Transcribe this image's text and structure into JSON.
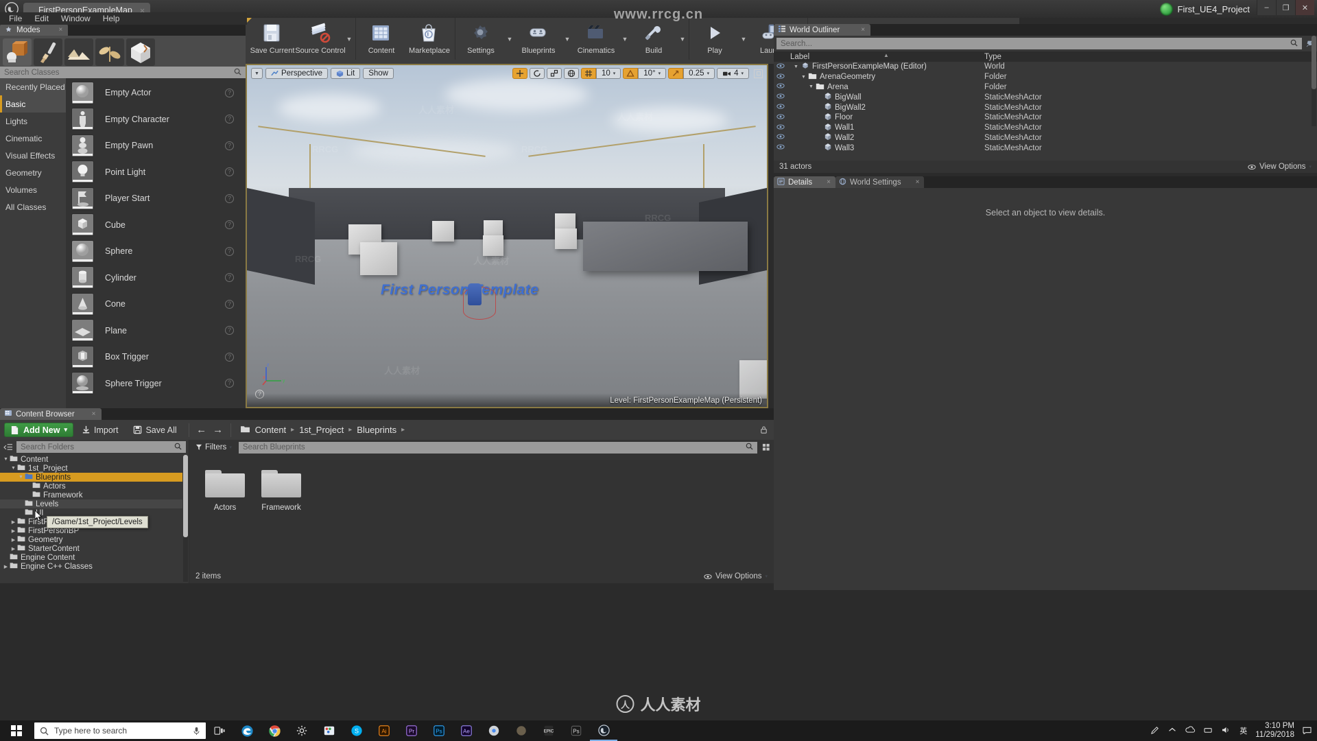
{
  "window": {
    "map_tab": "FirstPersonExampleMap",
    "watermark_top": "www.rrcg.cn",
    "project_name": "First_UE4_Project",
    "btn_minimize": "–",
    "btn_maximize": "❐",
    "btn_close": "✕"
  },
  "menu": {
    "items": [
      "File",
      "Edit",
      "Window",
      "Help"
    ]
  },
  "modes": {
    "tab_label": "Modes",
    "close": "×",
    "mode_buttons": [
      "place-mode",
      "paint-mode",
      "landscape-mode",
      "foliage-mode",
      "geometry-edit-mode"
    ],
    "search_placeholder": "Search Classes",
    "categories": [
      {
        "label": "Recently Placed",
        "state": "recent"
      },
      {
        "label": "Basic",
        "state": "selected"
      },
      {
        "label": "Lights",
        "state": "normal"
      },
      {
        "label": "Cinematic",
        "state": "normal"
      },
      {
        "label": "Visual Effects",
        "state": "normal"
      },
      {
        "label": "Geometry",
        "state": "normal"
      },
      {
        "label": "Volumes",
        "state": "normal"
      },
      {
        "label": "All Classes",
        "state": "normal"
      }
    ],
    "actors": [
      {
        "label": "Empty Actor",
        "icon": "sphere-thumb"
      },
      {
        "label": "Empty Character",
        "icon": "character-thumb"
      },
      {
        "label": "Empty Pawn",
        "icon": "pawn-thumb"
      },
      {
        "label": "Point Light",
        "icon": "pointlight-thumb"
      },
      {
        "label": "Player Start",
        "icon": "playerstart-thumb"
      },
      {
        "label": "Cube",
        "icon": "cube-thumb"
      },
      {
        "label": "Sphere",
        "icon": "sphere-thumb"
      },
      {
        "label": "Cylinder",
        "icon": "cylinder-thumb"
      },
      {
        "label": "Cone",
        "icon": "cone-thumb"
      },
      {
        "label": "Plane",
        "icon": "plane-thumb"
      },
      {
        "label": "Box Trigger",
        "icon": "boxtrigger-thumb"
      },
      {
        "label": "Sphere Trigger",
        "icon": "spheretrigger-thumb"
      }
    ],
    "help_glyph": "?"
  },
  "toolbar": {
    "groups": [
      {
        "items": [
          {
            "label": "Save Current",
            "icon": "save-icon",
            "caret": false
          },
          {
            "label": "Source Control",
            "icon": "source-control-icon",
            "caret": true
          }
        ]
      },
      {
        "items": [
          {
            "label": "Content",
            "icon": "content-icon",
            "caret": false
          },
          {
            "label": "Marketplace",
            "icon": "marketplace-icon",
            "caret": false
          }
        ]
      },
      {
        "items": [
          {
            "label": "Settings",
            "icon": "settings-icon",
            "caret": true
          },
          {
            "label": "Blueprints",
            "icon": "blueprints-icon",
            "caret": true
          },
          {
            "label": "Cinematics",
            "icon": "cinematics-icon",
            "caret": true
          },
          {
            "label": "Build",
            "icon": "build-icon",
            "caret": true
          }
        ]
      },
      {
        "items": [
          {
            "label": "Play",
            "icon": "play-icon",
            "caret": true
          },
          {
            "label": "Launch",
            "icon": "launch-icon",
            "caret": true
          }
        ]
      }
    ],
    "caret_glyph": "▼"
  },
  "viewport": {
    "view_menu_caret": "▼",
    "perspective": "Perspective",
    "lit": "Lit",
    "show": "Show",
    "grid_snap_value": "10",
    "rotation_snap_value": "10°",
    "scale_snap_value": "0.25",
    "camera_speed_value": "4",
    "level_label": "Level:",
    "level_name": "FirstPersonExampleMap (Persistent)",
    "overlay_title": "First Person Template",
    "axis_x": "x",
    "axis_y": "y",
    "axis_z": "z",
    "help_glyph": "?"
  },
  "outliner": {
    "tab_label": "World Outliner",
    "close": "×",
    "search_placeholder": "Search...",
    "columns": [
      "Label",
      "Type"
    ],
    "rows": [
      {
        "label": "FirstPersonExampleMap (Editor)",
        "type": "World",
        "indent": 0,
        "icon": "world-icon",
        "expander": "▼"
      },
      {
        "label": "ArenaGeometry",
        "type": "Folder",
        "indent": 1,
        "icon": "folder-icon",
        "expander": "▼"
      },
      {
        "label": "Arena",
        "type": "Folder",
        "indent": 2,
        "icon": "folder-icon",
        "expander": "▼"
      },
      {
        "label": "BigWall",
        "type": "StaticMeshActor",
        "indent": 3,
        "icon": "mesh-icon",
        "expander": ""
      },
      {
        "label": "BigWall2",
        "type": "StaticMeshActor",
        "indent": 3,
        "icon": "mesh-icon",
        "expander": ""
      },
      {
        "label": "Floor",
        "type": "StaticMeshActor",
        "indent": 3,
        "icon": "mesh-icon",
        "expander": ""
      },
      {
        "label": "Wall1",
        "type": "StaticMeshActor",
        "indent": 3,
        "icon": "mesh-icon",
        "expander": ""
      },
      {
        "label": "Wall2",
        "type": "StaticMeshActor",
        "indent": 3,
        "icon": "mesh-icon",
        "expander": ""
      },
      {
        "label": "Wall3",
        "type": "StaticMeshActor",
        "indent": 3,
        "icon": "mesh-icon",
        "expander": ""
      }
    ],
    "footer_count": "31 actors",
    "view_options": "View Options",
    "eye_glyph": "◉"
  },
  "details": {
    "tabs": [
      {
        "label": "Details",
        "active": true,
        "icon": "details-icon"
      },
      {
        "label": "World Settings",
        "active": false,
        "icon": "world-settings-icon"
      }
    ],
    "close": "×",
    "empty_message": "Select an object to view details."
  },
  "content_browser": {
    "tab_label": "Content Browser",
    "close": "×",
    "add_new": "Add New",
    "add_new_caret": "▾",
    "import": "Import",
    "save_all": "Save All",
    "back_arrow": "←",
    "forward_arrow": "→",
    "breadcrumbs": [
      "Content",
      "1st_Project",
      "Blueprints"
    ],
    "breadcrumb_sep": "▸",
    "search_folders_placeholder": "Search Folders",
    "filters_label": "Filters",
    "filters_caret": "▾",
    "search_assets_placeholder": "Search Blueprints",
    "tree": [
      {
        "label": "Content",
        "indent": 0,
        "expander": "▼",
        "state": "normal"
      },
      {
        "label": "1st_Project",
        "indent": 1,
        "expander": "▼",
        "state": "normal"
      },
      {
        "label": "Blueprints",
        "indent": 2,
        "expander": "▼",
        "state": "selected"
      },
      {
        "label": "Actors",
        "indent": 3,
        "expander": "",
        "state": "normal"
      },
      {
        "label": "Framework",
        "indent": 3,
        "expander": "",
        "state": "normal"
      },
      {
        "label": "Levels",
        "indent": 2,
        "expander": "",
        "state": "hover"
      },
      {
        "label": "UI",
        "indent": 2,
        "expander": "",
        "state": "normal"
      },
      {
        "label": "FirstPerson",
        "indent": 1,
        "expander": "▶",
        "state": "normal"
      },
      {
        "label": "FirstPersonBP",
        "indent": 1,
        "expander": "▶",
        "state": "normal"
      },
      {
        "label": "Geometry",
        "indent": 1,
        "expander": "▶",
        "state": "normal"
      },
      {
        "label": "StarterContent",
        "indent": 1,
        "expander": "▶",
        "state": "normal"
      },
      {
        "label": "Engine Content",
        "indent": 0,
        "expander": "",
        "state": "normal"
      },
      {
        "label": "Engine C++ Classes",
        "indent": 0,
        "expander": "▶",
        "state": "normal"
      }
    ],
    "assets": [
      {
        "name": "Actors",
        "kind": "folder"
      },
      {
        "name": "Framework",
        "kind": "folder"
      }
    ],
    "item_count": "2 items",
    "view_options": "View Options",
    "tooltip": "/Game/1st_Project/Levels"
  },
  "watermarks": {
    "center_text": "人人素材",
    "center_glyph": "人",
    "tiles": [
      "RRCG",
      "人人素材",
      "RRCG",
      "人人素材",
      "RRCG",
      "人人素材",
      "RRCG",
      "人人素材"
    ]
  },
  "taskbar": {
    "search_placeholder": "Type here to search",
    "apps": [
      "task-view",
      "edge",
      "chrome",
      "settings",
      "paint",
      "skype",
      "illustrator",
      "premiere",
      "photoshop",
      "after-effects",
      "chrome-alt",
      "unknown",
      "epic-games",
      "unreal-editor-alt",
      "unreal-editor"
    ],
    "time": "3:10 PM",
    "date": "11/29/2018",
    "lang": "英"
  },
  "colors": {
    "accent_orange": "#d79b20",
    "green_add": "#3f9b45",
    "panel_bg": "#383838",
    "viewport_border": "#8a7a44"
  }
}
